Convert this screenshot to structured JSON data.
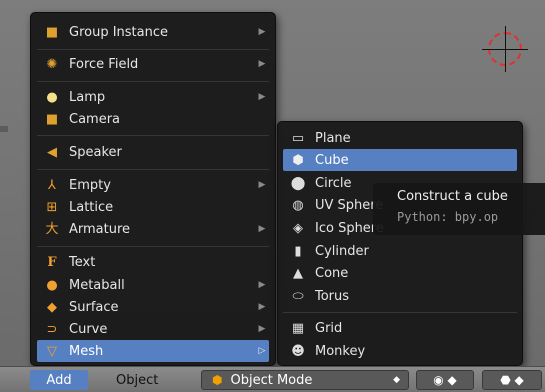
{
  "add_menu": {
    "items": [
      {
        "label": "Group Instance",
        "icon": "group-instance-icon",
        "glyph": "🗂",
        "has_submenu": true
      },
      {
        "label": "Force Field",
        "icon": "force-field-icon",
        "glyph": "⛶",
        "has_submenu": true
      },
      {
        "label": "Lamp",
        "icon": "lamp-icon",
        "glyph": "💡",
        "has_submenu": true
      },
      {
        "label": "Camera",
        "icon": "camera-icon",
        "glyph": "🎥",
        "has_submenu": false
      },
      {
        "label": "Speaker",
        "icon": "speaker-icon",
        "glyph": "◀)",
        "has_submenu": false
      },
      {
        "label": "Empty",
        "icon": "empty-icon",
        "glyph": "⅄",
        "has_submenu": true
      },
      {
        "label": "Lattice",
        "icon": "lattice-icon",
        "glyph": "⊞",
        "has_submenu": false
      },
      {
        "label": "Armature",
        "icon": "armature-icon",
        "glyph": "大",
        "has_submenu": true
      },
      {
        "label": "Text",
        "icon": "text-icon",
        "glyph": "F",
        "has_submenu": false
      },
      {
        "label": "Metaball",
        "icon": "metaball-icon",
        "glyph": "●",
        "has_submenu": true
      },
      {
        "label": "Surface",
        "icon": "surface-icon",
        "glyph": "◆",
        "has_submenu": true
      },
      {
        "label": "Curve",
        "icon": "curve-icon",
        "glyph": "⊃",
        "has_submenu": true
      },
      {
        "label": "Mesh",
        "icon": "mesh-icon",
        "glyph": "▽",
        "has_submenu": true,
        "highlighted": true
      }
    ]
  },
  "mesh_submenu": {
    "items": [
      {
        "label": "Plane",
        "icon": "plane-icon",
        "glyph": "▭"
      },
      {
        "label": "Cube",
        "icon": "cube-icon",
        "glyph": "⬢",
        "highlighted": true
      },
      {
        "label": "Circle",
        "icon": "circle-icon",
        "glyph": "⬤"
      },
      {
        "label": "UV Sphere",
        "icon": "uv-sphere-icon",
        "glyph": "◍"
      },
      {
        "label": "Ico Sphere",
        "icon": "ico-sphere-icon",
        "glyph": "◈"
      },
      {
        "label": "Cylinder",
        "icon": "cylinder-icon",
        "glyph": "▮"
      },
      {
        "label": "Cone",
        "icon": "cone-icon",
        "glyph": "▲"
      },
      {
        "label": "Torus",
        "icon": "torus-icon",
        "glyph": "⬭"
      },
      {
        "label": "Grid",
        "icon": "grid-icon",
        "glyph": "▦"
      },
      {
        "label": "Monkey",
        "icon": "monkey-icon",
        "glyph": "☻"
      }
    ]
  },
  "tooltip": {
    "title": "Construct a cube",
    "python": "Python: bpy.op"
  },
  "header": {
    "add_label": "Add",
    "object_label": "Object",
    "mode_label": "Object Mode",
    "mode_icon": "object-mode-cube-icon"
  },
  "colors": {
    "highlight": "#5680c2",
    "menu_bg": "#181818",
    "cursor_ring": "#e23030"
  }
}
